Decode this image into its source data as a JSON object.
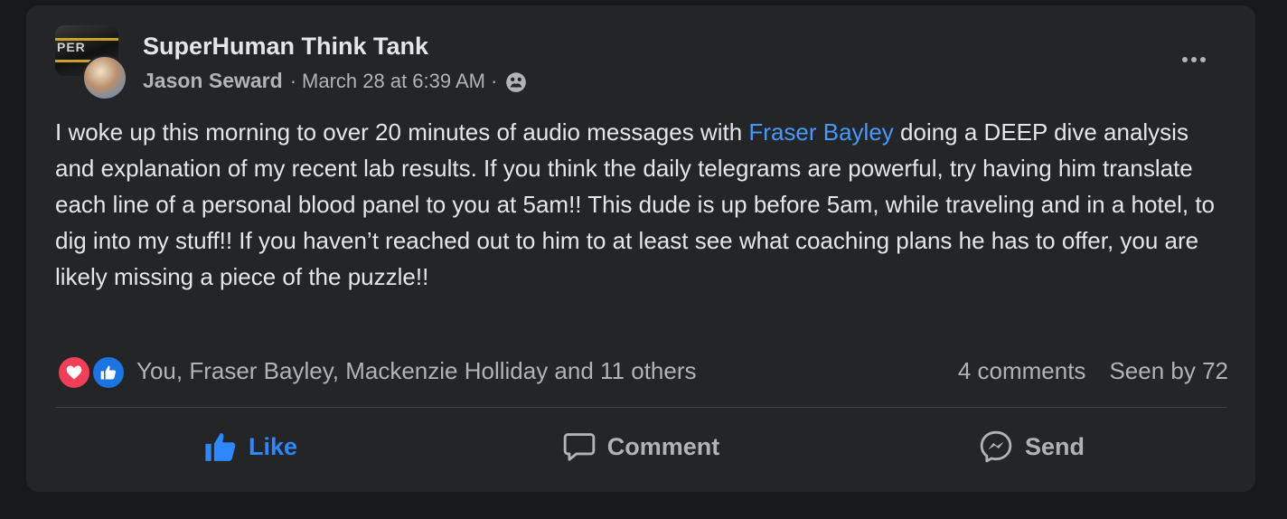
{
  "post": {
    "group_name": "SuperHuman Think Tank",
    "group_avatar_text": "PER",
    "author": "Jason Seward",
    "separator": "·",
    "timestamp": "March 28 at 6:39 AM",
    "audience_icon": "group-audience-icon",
    "body_before": "I woke up this morning to over 20 minutes of audio messages with ",
    "mention": "Fraser Bayley",
    "body_after": " doing a DEEP dive analysis and explanation of my recent lab results. If you think the daily telegrams are powerful, try having him translate each line of a personal blood panel to you at 5am!! This dude is up before 5am, while traveling and in a hotel, to dig into my stuff!! If you haven’t reached out to him to at least see what coaching plans he has to offer, you are likely missing a piece of the puzzle!!"
  },
  "reactions": {
    "types": [
      "love",
      "like"
    ],
    "summary": "You, Fraser Bayley, Mackenzie Holliday and 11 others",
    "comments": "4 comments",
    "seen": "Seen by 72"
  },
  "actions": {
    "like_label": "Like",
    "comment_label": "Comment",
    "send_label": "Send"
  },
  "colors": {
    "background": "#18191a",
    "card": "#242526",
    "primary_text": "#e4e6eb",
    "secondary_text": "#b0b3b8",
    "link": "#4599ff",
    "like_blue": "#2d88ff",
    "love_red": "#f33e58"
  }
}
